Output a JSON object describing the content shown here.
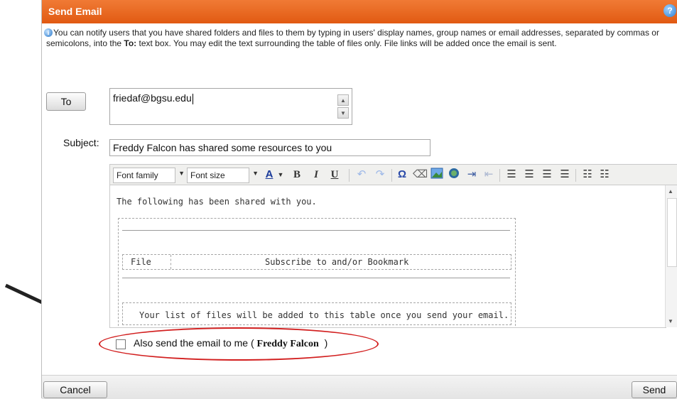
{
  "dialog": {
    "title": "Send Email",
    "info_part1": "You can notify users that you have shared folders and files to them by typing in users' display names, group names or email addresses, separated by commas or semicolons, into the ",
    "info_bold": "To:",
    "info_part2": " text box. You may edit the text surrounding the table of files only. File links will be added once the email is sent."
  },
  "form": {
    "to_button": "To",
    "to_value": "friedaf@bgsu.edu",
    "subject_label": "Subject:",
    "subject_value": "Freddy Falcon has shared some resources to you"
  },
  "toolbar": {
    "font_family": "Font family",
    "font_size": "Font size",
    "bold": "B",
    "italic": "I",
    "underline": "U",
    "omega": "Ω"
  },
  "editor": {
    "intro": "The following has been shared with you.",
    "col_file": "File",
    "col_subscribe": "Subscribe to and/or Bookmark",
    "placeholder_message": "Your list of files will be added to this table once you send your email."
  },
  "copy_option": {
    "label_prefix": "Also send the email to me (",
    "name": "Freddy Falcon",
    "label_suffix": ")"
  },
  "footer": {
    "cancel": "Cancel",
    "send": "Send"
  },
  "colors": {
    "titlebar": "#e8661f",
    "annotation_oval": "#d21f1f"
  }
}
